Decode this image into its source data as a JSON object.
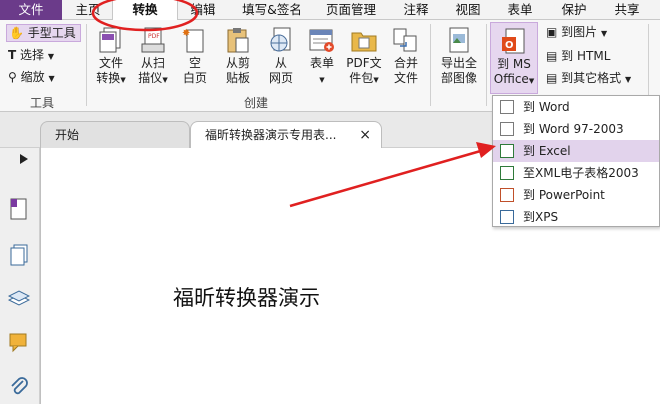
{
  "menubar": {
    "items": [
      "文件",
      "主页",
      "转换",
      "编辑",
      "填写&签名",
      "页面管理",
      "注释",
      "视图",
      "表单",
      "保护",
      "共享"
    ]
  },
  "ribbon": {
    "tools": {
      "hand_tool": "手型工具",
      "select": "选择",
      "zoom": "缩放",
      "group_label": "工具"
    },
    "create": {
      "file_convert": [
        "文件",
        "转换"
      ],
      "from_scanner": [
        "从扫",
        "描仪"
      ],
      "blank_page": [
        "空",
        "白页"
      ],
      "from_clipboard": [
        "从剪",
        "贴板"
      ],
      "from_webpage": [
        "从",
        "网页"
      ],
      "form": [
        "表单",
        ""
      ],
      "pdf_package": [
        "PDF文",
        "件包"
      ],
      "merge_files": [
        "合并",
        "文件"
      ],
      "group_label": "创建"
    },
    "export_images": [
      "导出全",
      "部图像"
    ],
    "to_ms_office": [
      "到 MS",
      "Office"
    ],
    "to_image": "到图片",
    "to_html": "到 HTML",
    "to_other": "到其它格式"
  },
  "tabs": {
    "start": "开始",
    "current": "福昕转换器演示专用表...",
    "close_glyph": "×"
  },
  "document": {
    "body_text": "福昕转换器演示"
  },
  "dropdown": {
    "items": [
      "到 Word",
      "到 Word 97-2003",
      "到 Excel",
      "至XML电子表格2003",
      "到 PowerPoint",
      "到XPS"
    ]
  },
  "colors": {
    "accent_purple": "#6b3b8a",
    "highlight": "#e2d3ec",
    "annotation_red": "#e02020"
  }
}
